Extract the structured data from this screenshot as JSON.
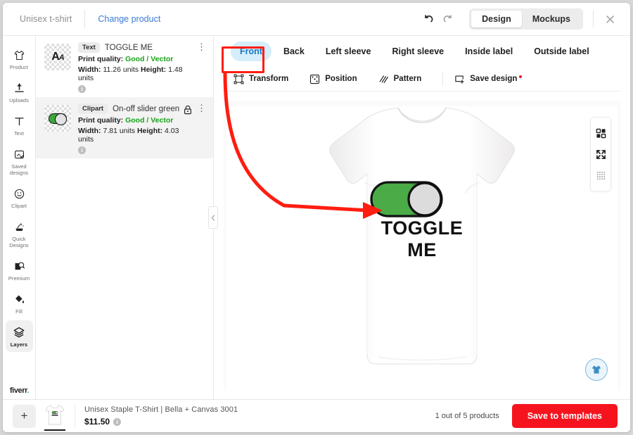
{
  "topbar": {
    "product_name": "Unisex t-shirt",
    "change_product": "Change product",
    "undo_icon": "undo-icon",
    "redo_icon": "redo-icon",
    "mode_design": "Design",
    "mode_mockups": "Mockups",
    "active_mode": "Design",
    "close_icon": "close-icon"
  },
  "rail": {
    "items": [
      {
        "label": "Product",
        "icon": "tshirt-icon",
        "active": false
      },
      {
        "label": "Uploads",
        "icon": "upload-icon",
        "active": false
      },
      {
        "label": "Text",
        "icon": "text-icon",
        "active": false
      },
      {
        "label": "Saved designs",
        "icon": "saved-designs-icon",
        "active": false
      },
      {
        "label": "Clipart",
        "icon": "smiley-icon",
        "active": false
      },
      {
        "label": "Quick Designs",
        "icon": "magic-icon",
        "active": false
      },
      {
        "label": "Premium",
        "icon": "premium-image-icon",
        "active": false
      },
      {
        "label": "Fill",
        "icon": "paint-bucket-icon",
        "active": false
      },
      {
        "label": "Layers",
        "icon": "layers-icon",
        "active": true
      }
    ],
    "brand": "fiverr"
  },
  "layers": [
    {
      "type_chip": "Text",
      "name": "TOGGLE ME",
      "quality_label": "Print quality:",
      "quality_value": "Good / Vector",
      "width_label": "Width:",
      "width_value": "11.26 units",
      "height_label": "Height:",
      "height_value": "1.48 units",
      "locked": false,
      "selected": false,
      "thumb": "text-thumbnail"
    },
    {
      "type_chip": "Clipart",
      "name": "On-off slider green",
      "quality_label": "Print quality:",
      "quality_value": "Good / Vector",
      "width_label": "Width:",
      "width_value": "7.81 units",
      "height_label": "Height:",
      "height_value": "4.03 units",
      "locked": true,
      "selected": true,
      "thumb": "toggle-thumbnail"
    }
  ],
  "editor": {
    "tabs": [
      {
        "label": "Front",
        "active": true
      },
      {
        "label": "Back",
        "active": false
      },
      {
        "label": "Left sleeve",
        "active": false
      },
      {
        "label": "Right sleeve",
        "active": false
      },
      {
        "label": "Inside label",
        "active": false
      },
      {
        "label": "Outside label",
        "active": false
      }
    ],
    "tools": [
      {
        "label": "Transform",
        "icon": "transform-icon"
      },
      {
        "label": "Position",
        "icon": "position-icon"
      },
      {
        "label": "Pattern",
        "icon": "pattern-icon"
      },
      {
        "label": "Save design",
        "icon": "save-design-icon",
        "dirty": true
      }
    ],
    "canvas_controls": [
      {
        "icon": "grid-templates-icon"
      },
      {
        "icon": "fullscreen-icon"
      },
      {
        "icon": "dot-grid-icon"
      }
    ],
    "fab_icon": "tshirt-preview-icon",
    "design": {
      "toggle_icon": "on-off-slider-green",
      "caption": "TOGGLE ME"
    }
  },
  "bottom": {
    "add_label": "+",
    "product_title": "Unisex Staple T-Shirt | Bella + Canvas 3001",
    "price": "$11.50",
    "info_icon": "info-icon",
    "product_count": "1 out of 5 products",
    "save_button": "Save to templates"
  },
  "annotation": {
    "highlight_target": "Front",
    "arrow_color": "#ff1d10"
  },
  "colors": {
    "accent_red": "#f5141e",
    "link_blue": "#3a7bd5",
    "tab_active_bg": "#d6edfb",
    "tab_active_text": "#1878c4",
    "quality_green": "#19a319",
    "toggle_green": "#3aa93a"
  }
}
